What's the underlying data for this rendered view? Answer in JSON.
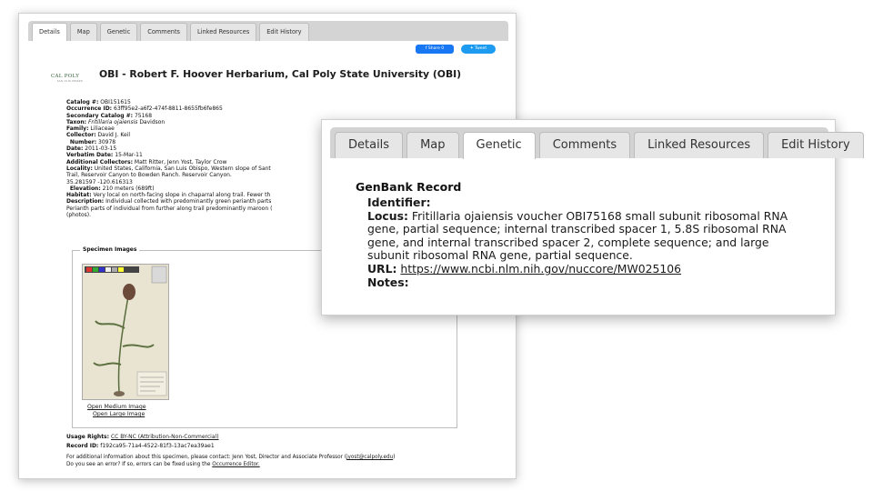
{
  "back": {
    "tabs": [
      "Details",
      "Map",
      "Genetic",
      "Comments",
      "Linked Resources",
      "Edit History"
    ],
    "active_tab": 0,
    "share_label": "Share 0",
    "tweet_label": "Tweet",
    "logo": "CAL POLY",
    "logo_sub": "SAN LUIS OBISPO",
    "title": "OBI - Robert F. Hoover Herbarium, Cal Poly State University (OBI)",
    "details": {
      "catalog_label": "Catalog #:",
      "catalog": "OBI151615",
      "occurrence_label": "Occurrence ID:",
      "occurrence": "63ff95e2-a6f2-474f-8811-8655fb6fe865",
      "secondary_label": "Secondary Catalog #:",
      "secondary": "75168",
      "taxon_label": "Taxon:",
      "taxon_name": "Fritillaria ojaiensis",
      "taxon_author": "Davidson",
      "family_label": "Family:",
      "family": "Liliaceae",
      "collector_label": "Collector:",
      "collector": "David J. Keil",
      "number_label": "Number:",
      "number": "30978",
      "date_label": "Date:",
      "date": "2011-03-15",
      "verbatim_label": "Verbatim Date:",
      "verbatim": "15-Mar-11",
      "addcoll_label": "Additional Collectors:",
      "addcoll": "Matt Ritter, Jenn Yost, Taylor Crow",
      "locality_label": "Locality:",
      "locality": "United States, California, San Luis Obispo, Western slope of Sant",
      "locality2": "Trail, Reservoir Canyon to Bowden Ranch. Reservoir Canyon.",
      "coords": "35.281597  -120.616313",
      "elevation_label": "Elevation:",
      "elevation": "210 meters (689ft)",
      "habitat_label": "Habitat:",
      "habitat": "Very local on north-facing slope in chaparral along trail. Fewer th",
      "description_label": "Description:",
      "description": "Individual collected with predominantly green perianth parts",
      "description2": "Perianth parts of individual from further along trail predominantly maroon (",
      "description3": "(photos)."
    },
    "specimen": {
      "legend": "Specimen Images",
      "open_medium": "Open Medium Image",
      "open_large": "Open Large Image"
    },
    "usage_label": "Usage Rights:",
    "usage": "CC BY-NC (Attribution-Non-Commercial)",
    "record_label": "Record ID:",
    "record": "f192ca95-71a4-4522-81f3-13ac7ea39ae1",
    "contact_prefix": "For additional information about this specimen, please contact: Jenn Yost, Director and Associate Professor (",
    "contact_email": "jyost@calpoly.edu",
    "contact_suffix": ")",
    "error_prefix": "Do you see an error? If so, errors can be fixed using the ",
    "error_link": "Occurrence Editor."
  },
  "front": {
    "tabs": [
      "Details",
      "Map",
      "Genetic",
      "Comments",
      "Linked Resources",
      "Edit History"
    ],
    "active_tab": 2,
    "section_title": "GenBank Record",
    "identifier_label": "Identifier:",
    "locus_label": "Locus:",
    "locus": "Fritillaria ojaiensis voucher OBI75168 small subunit ribosomal RNA gene, partial sequence; internal transcribed spacer 1, 5.8S ribosomal RNA gene, and internal transcribed spacer 2, complete sequence; and large subunit ribosomal RNA gene, partial sequence.",
    "url_label": "URL:",
    "url": "https://www.ncbi.nlm.nih.gov/nuccore/MW025106",
    "notes_label": "Notes:"
  }
}
